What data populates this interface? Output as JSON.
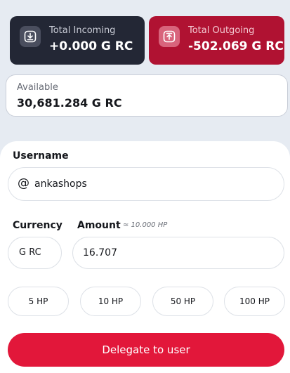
{
  "summary": {
    "incoming": {
      "label": "Total Incoming",
      "value": "+0.000 G RC",
      "icon": "download-icon"
    },
    "outgoing": {
      "label": "Total Outgoing",
      "value": "-502.069 G RC",
      "icon": "upload-icon"
    }
  },
  "available": {
    "label": "Available",
    "value": "30,681.284 G RC"
  },
  "form": {
    "username_label": "Username",
    "username_prefix": "@",
    "username_value": "ankashops",
    "currency_label": "Currency",
    "currency_value": "G RC",
    "amount_label": "Amount",
    "amount_approx": "≈ 10.000 HP",
    "amount_value": "16.707",
    "presets": [
      "5 HP",
      "10 HP",
      "50 HP",
      "100 HP"
    ],
    "submit_label": "Delegate to user"
  },
  "colors": {
    "incoming_card": "#232735",
    "outgoing_card": "#b01232",
    "accent": "#e2173a",
    "background": "#e6ebf2"
  }
}
